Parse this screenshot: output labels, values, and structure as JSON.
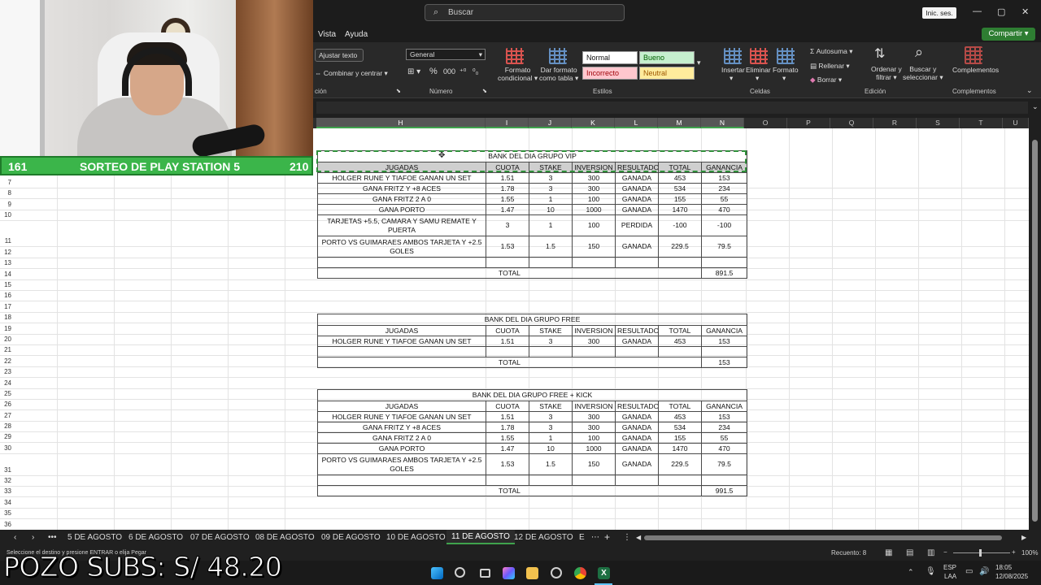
{
  "titlebar": {
    "search_placeholder": "Buscar",
    "signin_label": "Inic. ses.",
    "minimize": "—",
    "restore": "▢",
    "close": "✕"
  },
  "menu": {
    "tabs": [
      "Vista",
      "Ayuda"
    ],
    "share_label": "Compartir"
  },
  "ribbon": {
    "wrap_text": "Ajustar texto",
    "merge_center": "Combinar y centrar",
    "alignment_group": "ción",
    "number_format": "General",
    "number_group": "Número",
    "conditional_format": [
      "Formato",
      "condicional"
    ],
    "format_as_table": [
      "Dar formato",
      "como tabla"
    ],
    "styles": {
      "normal": "Normal",
      "bueno": "Bueno",
      "incorrecto": "Incorrecto",
      "neutral": "Neutral"
    },
    "styles_group": "Estilos",
    "insert": "Insertar",
    "delete": "Eliminar",
    "format": "Formato",
    "cells_group": "Celdas",
    "autosum": "Autosuma",
    "fill": "Rellenar",
    "clear": "Borrar",
    "sort_filter": [
      "Ordenar y",
      "filtrar"
    ],
    "find_select": [
      "Buscar y",
      "seleccionar"
    ],
    "editing_group": "Edición",
    "addins": "Complementos",
    "addins_group": "Complementos"
  },
  "columns": [
    "H",
    "I",
    "J",
    "K",
    "L",
    "M",
    "N",
    "O",
    "P",
    "Q",
    "R",
    "S",
    "T",
    "U"
  ],
  "rows": [
    "7",
    "8",
    "9",
    "10",
    "11",
    "12",
    "13",
    "14",
    "15",
    "16",
    "17",
    "18",
    "19",
    "20",
    "21",
    "22",
    "23",
    "24",
    "25",
    "26",
    "27",
    "28",
    "29",
    "30",
    "31",
    "32",
    "33",
    "34",
    "35",
    "36"
  ],
  "vip": {
    "title": "BANK DEL DIA GRUPO VIP",
    "headers": [
      "JUGADAS",
      "CUOTA",
      "STAKE",
      "INVERSION",
      "RESULTADO",
      "TOTAL",
      "GANANCIA"
    ],
    "rows": [
      [
        "HOLGER RUNE Y TIAFOE GANAN UN SET",
        "1.51",
        "3",
        "300",
        "GANADA",
        "453",
        "153"
      ],
      [
        "GANA FRITZ Y +8 ACES",
        "1.78",
        "3",
        "300",
        "GANADA",
        "534",
        "234"
      ],
      [
        "GANA FRITZ 2 A 0",
        "1.55",
        "1",
        "100",
        "GANADA",
        "155",
        "55"
      ],
      [
        "GANA PORTO",
        "1.47",
        "10",
        "1000",
        "GANADA",
        "1470",
        "470"
      ],
      [
        "TARJETAS +5.5, CAMARA Y SAMU REMATE Y PUERTA",
        "3",
        "1",
        "100",
        "PERDIDA",
        "-100",
        "-100"
      ],
      [
        "PORTO VS GUIMARAES AMBOS TARJETA Y +2.5 GOLES",
        "1.53",
        "1.5",
        "150",
        "GANADA",
        "229.5",
        "79.5"
      ]
    ],
    "total_label": "TOTAL",
    "total_value": "891.5"
  },
  "free": {
    "title": "BANK DEL DIA GRUPO FREE",
    "headers": [
      "JUGADAS",
      "CUOTA",
      "STAKE",
      "INVERSION",
      "RESULTADO",
      "TOTAL",
      "GANANCIA"
    ],
    "rows": [
      [
        "HOLGER RUNE Y TIAFOE GANAN UN SET",
        "1.51",
        "3",
        "300",
        "GANADA",
        "453",
        "153"
      ]
    ],
    "total_label": "TOTAL",
    "total_value": "153"
  },
  "kick": {
    "title": "BANK DEL DIA GRUPO FREE + KICK",
    "headers": [
      "JUGADAS",
      "CUOTA",
      "STAKE",
      "INVERSION",
      "RESULTADO",
      "TOTAL",
      "GANANCIA"
    ],
    "rows": [
      [
        "HOLGER RUNE Y TIAFOE GANAN UN SET",
        "1.51",
        "3",
        "300",
        "GANADA",
        "453",
        "153"
      ],
      [
        "GANA FRITZ Y +8 ACES",
        "1.78",
        "3",
        "300",
        "GANADA",
        "534",
        "234"
      ],
      [
        "GANA FRITZ 2 A 0",
        "1.55",
        "1",
        "100",
        "GANADA",
        "155",
        "55"
      ],
      [
        "GANA PORTO",
        "1.47",
        "10",
        "1000",
        "GANADA",
        "1470",
        "470"
      ],
      [
        "PORTO VS GUIMARAES AMBOS TARJETA Y +2.5 GOLES",
        "1.53",
        "1.5",
        "150",
        "GANADA",
        "229.5",
        "79.5"
      ]
    ],
    "total_label": "TOTAL",
    "total_value": "991.5"
  },
  "sheet_tabs": [
    "5 DE AGOSTO",
    "6 DE AGOSTO",
    "07 DE AGOSTO",
    "08 DE AGOSTO",
    "09 DE AGOSTO",
    "10 DE AGOSTO",
    "11 DE AGOSTO",
    "12 DE AGOSTO",
    "E"
  ],
  "active_tab": "11 DE AGOSTO",
  "status": {
    "message": "Seleccione el destino y presione ENTRAR o elija Pegar",
    "count": "Recuento: 8",
    "zoom": "100%"
  },
  "taskbar": {
    "lang": "ESP",
    "region": "LAA",
    "time": "18:05",
    "date": "12/08/2025"
  },
  "overlay": {
    "banner_left": "161",
    "banner_title": "SORTEO DE PLAY STATION 5",
    "banner_right": "210",
    "pozo": "POZO SUBS: S/ 48.20"
  },
  "colors": {
    "accent_green": "#3bb54a",
    "excel_green": "#2e7d32",
    "bueno_bg": "#c6efce",
    "bueno_fg": "#006100",
    "incorrecto_bg": "#ffc7ce",
    "incorrecto_fg": "#9c0006",
    "neutral_bg": "#ffeb9c",
    "neutral_fg": "#9c5700"
  }
}
